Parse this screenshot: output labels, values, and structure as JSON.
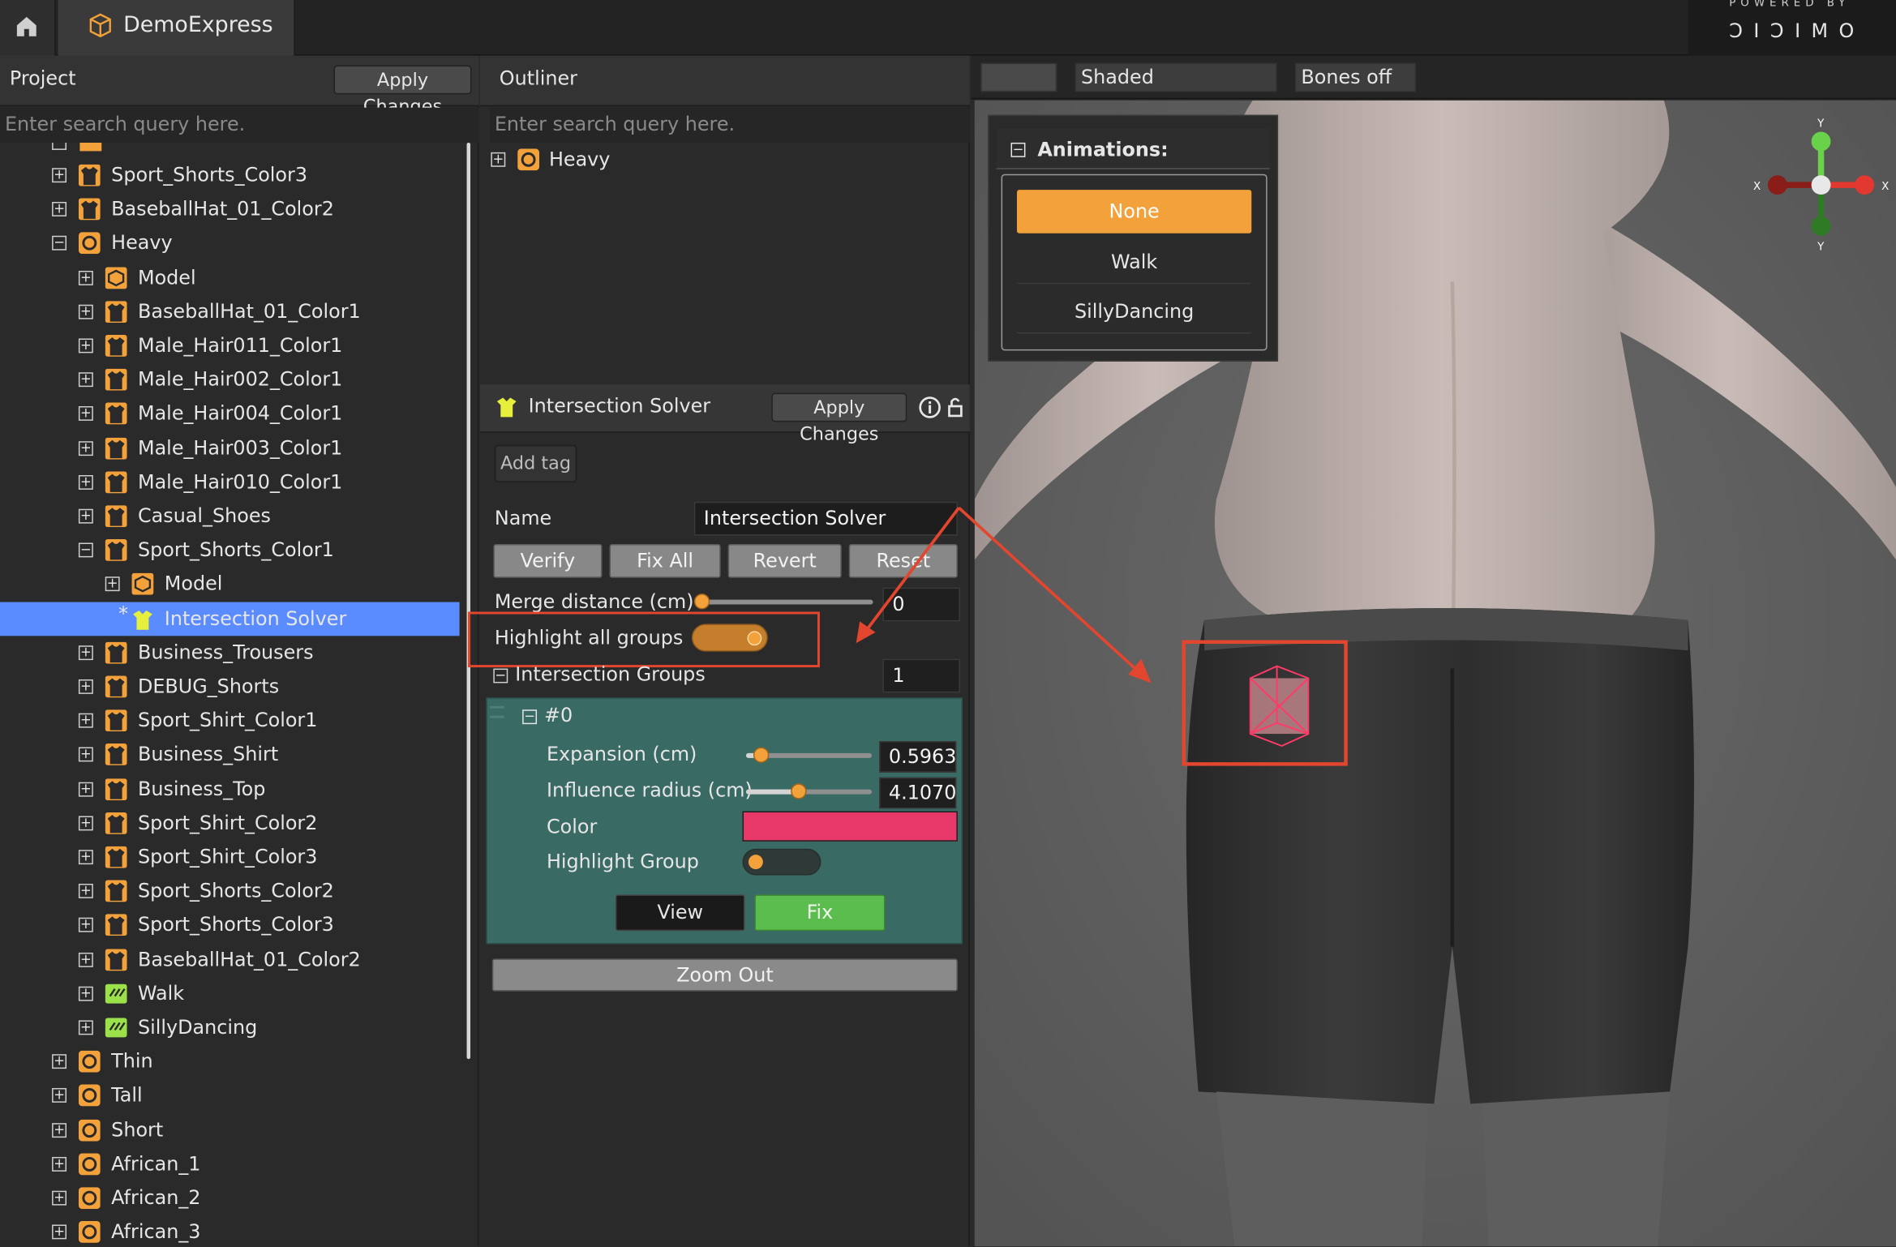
{
  "top": {
    "tab_title": "DemoExpress",
    "brand_top": "POWERED BY",
    "brand_name": "ƆIƆIMO"
  },
  "project": {
    "title": "Project",
    "apply_label": "Apply Changes",
    "search_placeholder": "Enter search query here.",
    "tree": [
      {
        "label": "Sport_Shorts_Color3",
        "icon": "shirt-icon",
        "level": 1,
        "expander": "+"
      },
      {
        "label": "BaseballHat_01_Color2",
        "icon": "shirt-icon",
        "level": 1,
        "expander": "+"
      },
      {
        "label": "Heavy",
        "icon": "avatar-icon",
        "level": 1,
        "expander": "-"
      },
      {
        "label": "Model",
        "icon": "model-icon",
        "level": 2,
        "expander": "+"
      },
      {
        "label": "BaseballHat_01_Color1",
        "icon": "shirt-icon",
        "level": 2,
        "expander": "+"
      },
      {
        "label": "Male_Hair011_Color1",
        "icon": "shirt-icon",
        "level": 2,
        "expander": "+"
      },
      {
        "label": "Male_Hair002_Color1",
        "icon": "shirt-icon",
        "level": 2,
        "expander": "+"
      },
      {
        "label": "Male_Hair004_Color1",
        "icon": "shirt-icon",
        "level": 2,
        "expander": "+"
      },
      {
        "label": "Male_Hair003_Color1",
        "icon": "shirt-icon",
        "level": 2,
        "expander": "+"
      },
      {
        "label": "Male_Hair010_Color1",
        "icon": "shirt-icon",
        "level": 2,
        "expander": "+"
      },
      {
        "label": "Casual_Shoes",
        "icon": "shirt-icon",
        "level": 2,
        "expander": "+"
      },
      {
        "label": "Sport_Shorts_Color1",
        "icon": "shirt-icon",
        "level": 2,
        "expander": "-"
      },
      {
        "label": "Model",
        "icon": "model-icon",
        "level": 3,
        "expander": "+"
      },
      {
        "label": "Intersection Solver",
        "icon": "solver-icon",
        "level": 3,
        "expander": "*",
        "selected": true
      },
      {
        "label": "Business_Trousers",
        "icon": "shirt-icon",
        "level": 2,
        "expander": "+"
      },
      {
        "label": "DEBUG_Shorts",
        "icon": "shirt-icon",
        "level": 2,
        "expander": "+"
      },
      {
        "label": "Sport_Shirt_Color1",
        "icon": "shirt-icon",
        "level": 2,
        "expander": "+"
      },
      {
        "label": "Business_Shirt",
        "icon": "shirt-icon",
        "level": 2,
        "expander": "+"
      },
      {
        "label": "Business_Top",
        "icon": "shirt-icon",
        "level": 2,
        "expander": "+"
      },
      {
        "label": "Sport_Shirt_Color2",
        "icon": "shirt-icon",
        "level": 2,
        "expander": "+"
      },
      {
        "label": "Sport_Shirt_Color3",
        "icon": "shirt-icon",
        "level": 2,
        "expander": "+"
      },
      {
        "label": "Sport_Shorts_Color2",
        "icon": "shirt-icon",
        "level": 2,
        "expander": "+"
      },
      {
        "label": "Sport_Shorts_Color3",
        "icon": "shirt-icon",
        "level": 2,
        "expander": "+"
      },
      {
        "label": "BaseballHat_01_Color2",
        "icon": "shirt-icon",
        "level": 2,
        "expander": "+"
      },
      {
        "label": "Walk",
        "icon": "animation-icon",
        "level": 2,
        "expander": "+"
      },
      {
        "label": "SillyDancing",
        "icon": "animation-icon",
        "level": 2,
        "expander": "+"
      },
      {
        "label": "Thin",
        "icon": "avatar-icon",
        "level": 1,
        "expander": "+"
      },
      {
        "label": "Tall",
        "icon": "avatar-icon",
        "level": 1,
        "expander": "+"
      },
      {
        "label": "Short",
        "icon": "avatar-icon",
        "level": 1,
        "expander": "+"
      },
      {
        "label": "African_1",
        "icon": "avatar-icon",
        "level": 1,
        "expander": "+"
      },
      {
        "label": "African_2",
        "icon": "avatar-icon",
        "level": 1,
        "expander": "+"
      },
      {
        "label": "African_3",
        "icon": "avatar-icon",
        "level": 1,
        "expander": "+"
      }
    ]
  },
  "outliner": {
    "title": "Outliner",
    "search_placeholder": "Enter search query here.",
    "item_label": "Heavy"
  },
  "inspector": {
    "title": "Intersection Solver",
    "apply_label": "Apply Changes",
    "add_tag": "Add tag",
    "name_label": "Name",
    "name_value": "Intersection Solver",
    "buttons": [
      "Verify",
      "Fix All",
      "Revert",
      "Reset"
    ],
    "merge_label": "Merge distance (cm)",
    "merge_value": "0",
    "merge_fraction": 0.0,
    "highlight_all_label": "Highlight all groups",
    "highlight_all_on": true,
    "groups_label": "Intersection Groups",
    "groups_value": "1",
    "group": {
      "title": "#0",
      "expansion_label": "Expansion (cm)",
      "expansion_value": "0.5963",
      "expansion_fraction": 0.12,
      "influence_label": "Influence radius (cm)",
      "influence_value": "4.1070",
      "influence_fraction": 0.41,
      "color_label": "Color",
      "color_hex": "#e8386a",
      "highlight_label": "Highlight Group",
      "highlight_on": false,
      "view_label": "View",
      "fix_label": "Fix"
    },
    "zoom_out": "Zoom Out"
  },
  "viewport": {
    "toolbar": [
      "",
      "Shaded",
      "Bones off"
    ],
    "animations_title": "Animations:",
    "animations": [
      "None",
      "Walk",
      "SillyDancing"
    ],
    "selected_animation": "None",
    "gizmo_labels": {
      "y": "Y",
      "x": "X",
      "y2": "Y",
      "x2": "X"
    }
  },
  "colors": {
    "accent_orange": "#f3a13a",
    "selection_blue": "#5b8cff",
    "group_bg": "#3a6a64",
    "fix_green": "#5bbd4e",
    "annotation_red": "#e2462f"
  }
}
